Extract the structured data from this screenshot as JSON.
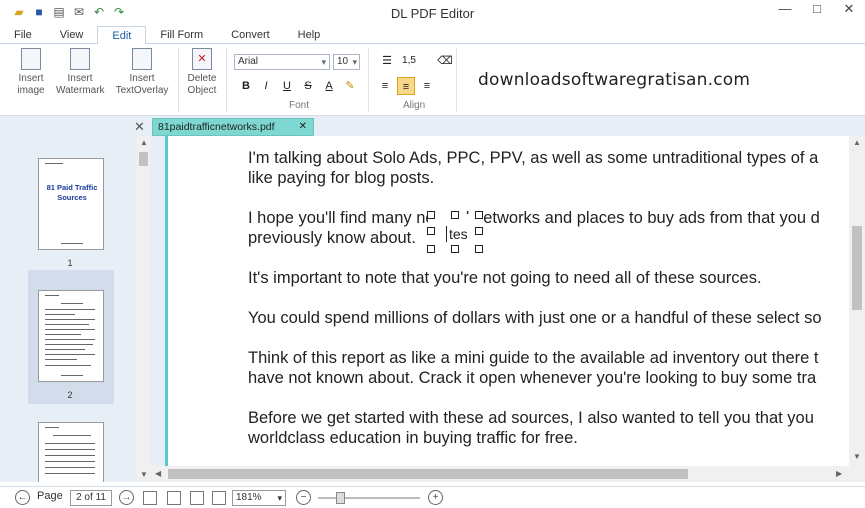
{
  "window": {
    "title": "DL PDF Editor",
    "controls": [
      "—",
      "□",
      "✕"
    ]
  },
  "quick_access": [
    "open-icon",
    "save-icon",
    "print-icon",
    "email-icon",
    "undo-icon",
    "redo-icon"
  ],
  "menu": {
    "items": [
      "File",
      "View",
      "Edit",
      "Fill Form",
      "Convert",
      "Help"
    ],
    "active": "Edit"
  },
  "ribbon": {
    "insert_image": "Insert\nimage",
    "insert_watermark": "Insert\nWatermark",
    "insert_textoverlay": "Insert\nTextOverlay",
    "delete_object": "Delete\nObject",
    "font_name": "Arial",
    "font_size": "10",
    "bold": "B",
    "italic": "I",
    "underline": "U",
    "strike": "S",
    "color": "A",
    "line_spacing": "1,5",
    "font_group": "Font",
    "align_group": "Align",
    "brand_text": "downloadsoftwaregratisan.com"
  },
  "tabs": {
    "document": "81paidtrafficnetworks.pdf"
  },
  "thumbnails": {
    "page1_title": "81 Paid Traffic Sources",
    "labels": [
      "1",
      "2"
    ]
  },
  "document": {
    "paragraphs": [
      [
        "I'm talking about Solo Ads, PPC, PPV, as well as some untraditional types of a",
        "like paying for blog posts."
      ],
      [
        "I hope you'll find many new ad networks and places to buy ads from that you d",
        "previously know about."
      ],
      [
        "It's important to note that you're not going to need all of these sources."
      ],
      [
        "You could spend millions of dollars with just one or a handful of these select so"
      ],
      [
        "Think of this report as like a mini guide to the available ad inventory out there t",
        "have not known about.  Crack it open whenever you're looking to buy some tra"
      ],
      [
        "Before we get started with these ad sources, I also wanted to tell you that you",
        "worldclass education in buying traffic for free."
      ]
    ],
    "overlay_text": "tes"
  },
  "status": {
    "page_label": "Page",
    "page_value": "2 of 11",
    "zoom": "181%"
  }
}
